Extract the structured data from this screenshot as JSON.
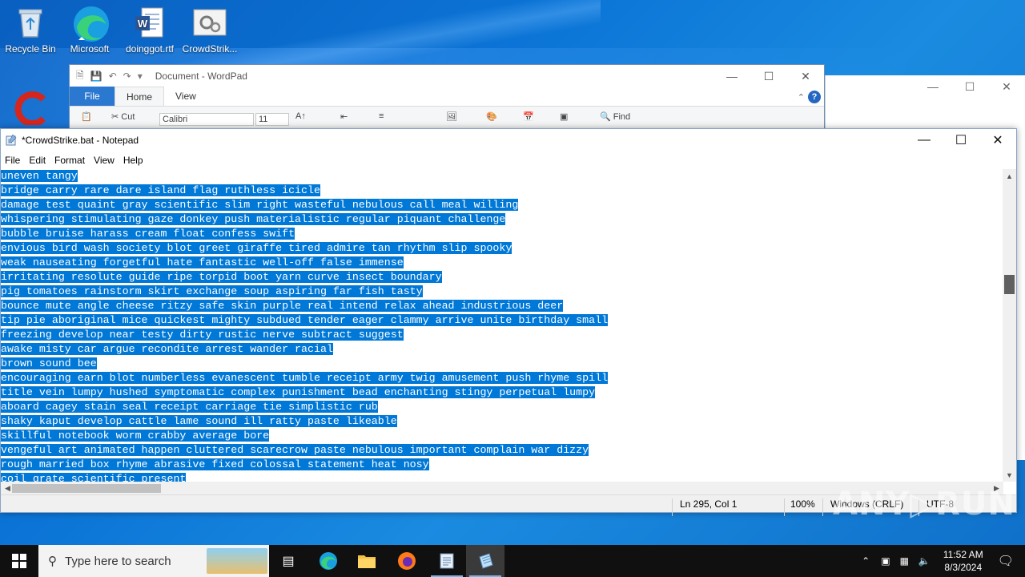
{
  "desktop": {
    "icons": [
      {
        "label": "Recycle Bin"
      },
      {
        "label": "Microsoft Edge"
      },
      {
        "label": "doinggot.rtf"
      },
      {
        "label": "CrowdStrik..."
      }
    ]
  },
  "wordpad": {
    "title": "Document - WordPad",
    "tabs": [
      "File",
      "Home",
      "View"
    ],
    "ribbon": {
      "cut": "Cut",
      "font": "Calibri",
      "size": "11",
      "find": "Find"
    }
  },
  "notepad": {
    "title": "*CrowdStrike.bat - Notepad",
    "menu": [
      "File",
      "Edit",
      "Format",
      "View",
      "Help"
    ],
    "lines": [
      "uneven tangy",
      "bridge carry rare dare island flag ruthless icicle",
      "damage test quaint gray scientific slim right wasteful nebulous call meal willing",
      "whispering stimulating gaze donkey push materialistic regular piquant challenge",
      "bubble bruise harass cream float confess swift",
      "envious bird wash society blot greet giraffe tired admire tan rhythm slip spooky",
      "weak nauseating forgetful hate fantastic well-off false immense",
      "irritating resolute guide ripe torpid boot yarn curve insect boundary",
      "pig tomatoes rainstorm skirt exchange soup aspiring far fish tasty",
      "bounce mute angle cheese ritzy safe skin purple real intend relax ahead industrious deer",
      "tip pie aboriginal mice quickest mighty subdued tender eager clammy arrive unite birthday small",
      "freezing develop near testy dirty rustic nerve subtract suggest",
      "awake misty car argue recondite arrest wander racial",
      "brown sound bee",
      "encouraging earn blot numberless evanescent tumble receipt army twig amusement push rhyme spill",
      "title vein lumpy hushed symptomatic complex punishment bead enchanting stingy perpetual lumpy",
      "aboard cagey stain seal receipt carriage tie simplistic rub",
      "shaky kaput develop cattle lame sound ill ratty paste likeable",
      "skillful notebook worm crabby average bore",
      "vengeful art animated happen cluttered scarecrow paste nebulous important complain war dizzy",
      "rough married box rhyme abrasive fixed colossal statement heat nosy",
      "coil grate scientific present"
    ],
    "status": {
      "position": "Ln 295, Col 1",
      "zoom": "100%",
      "line_ending": "Windows (CRLF)",
      "encoding": "UTF-8"
    }
  },
  "taskbar": {
    "search_placeholder": "Type here to search",
    "time": "11:52 AM",
    "date": "8/3/2024"
  },
  "watermark": "ANY RUN"
}
